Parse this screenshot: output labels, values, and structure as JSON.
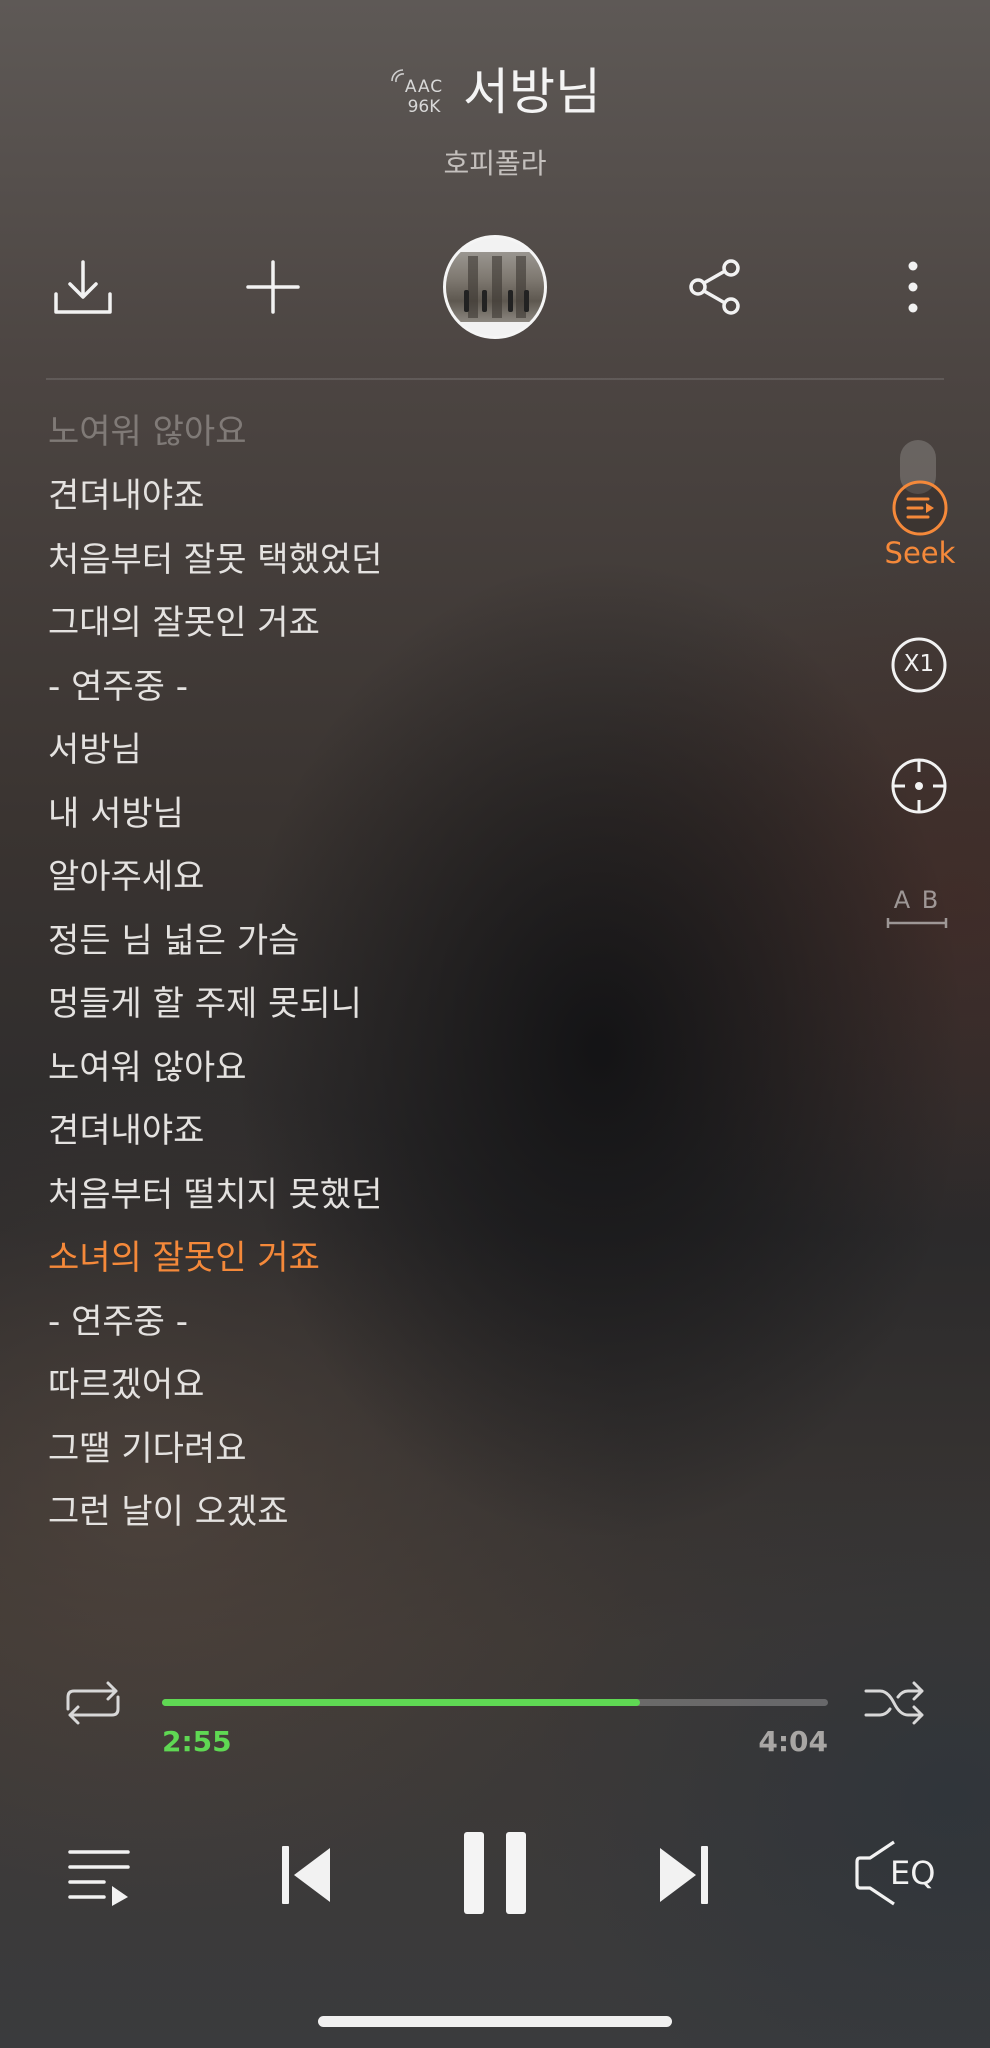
{
  "header": {
    "quality_line1": "AAC",
    "quality_line2": "96K",
    "title": "서방님",
    "artist": "호피폴라"
  },
  "actions": {
    "download_icon": "download-icon",
    "add_icon": "plus-icon",
    "share_icon": "share-icon",
    "more_icon": "more-vertical-icon"
  },
  "lyrics": [
    {
      "text": "노여워 않아요",
      "state": "fade"
    },
    {
      "text": "견뎌내야죠",
      "state": ""
    },
    {
      "text": "처음부터 잘못 택했었던",
      "state": ""
    },
    {
      "text": "그대의 잘못인 거죠",
      "state": ""
    },
    {
      "text": " - 연주중 -",
      "state": ""
    },
    {
      "text": "서방님",
      "state": ""
    },
    {
      "text": "내 서방님",
      "state": ""
    },
    {
      "text": "알아주세요",
      "state": ""
    },
    {
      "text": "정든 님 넓은 가슴",
      "state": ""
    },
    {
      "text": "멍들게 할 주제 못되니",
      "state": ""
    },
    {
      "text": "노여워 않아요",
      "state": ""
    },
    {
      "text": "견뎌내야죠",
      "state": ""
    },
    {
      "text": "처음부터 떨치지 못했던",
      "state": ""
    },
    {
      "text": "소녀의 잘못인 거죠",
      "state": "active"
    },
    {
      "text": " - 연주중 -",
      "state": ""
    },
    {
      "text": "따르겠어요",
      "state": ""
    },
    {
      "text": "그땔 기다려요",
      "state": ""
    },
    {
      "text": "그런 날이 오겠죠",
      "state": ""
    }
  ],
  "side": {
    "seek_label": "Seek",
    "speed_label": "X1",
    "ab_label": "A B"
  },
  "progress": {
    "current": "2:55",
    "total": "4:04",
    "fraction": 0.717
  },
  "colors": {
    "accent": "#f5893a",
    "progress": "#5fd853"
  },
  "controls": {
    "eq_label": "EQ"
  }
}
